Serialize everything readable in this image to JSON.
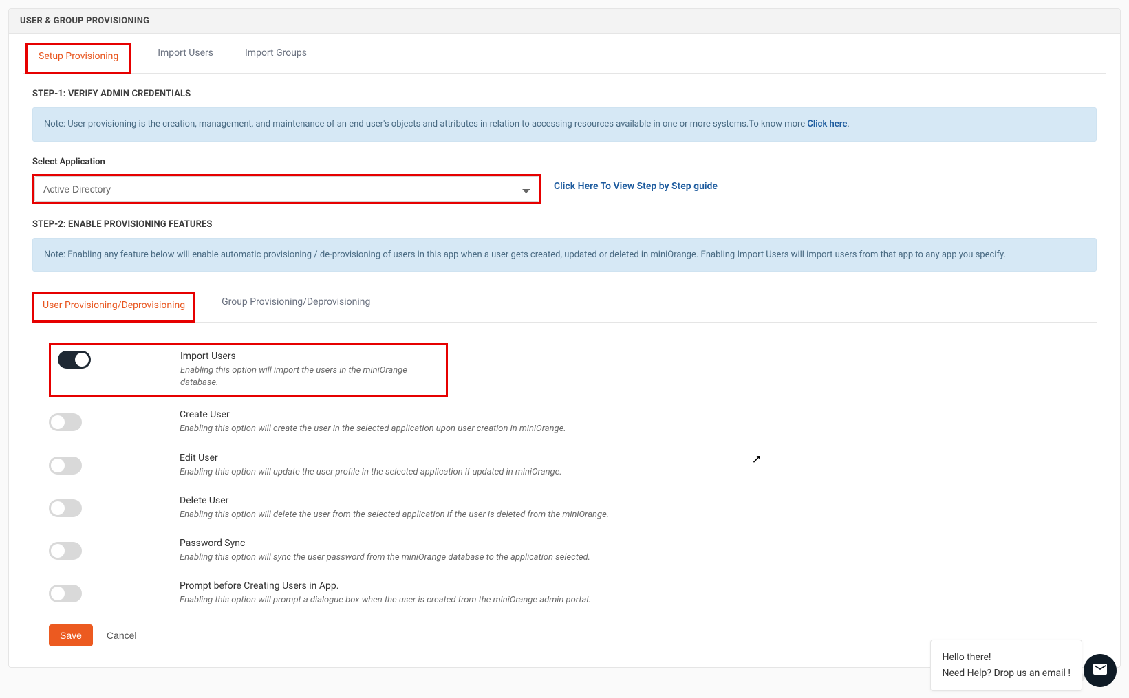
{
  "colors": {
    "accent": "#ec5a20",
    "highlight": "#e60000",
    "note_bg": "#d6e8f5",
    "toggle_on": "#1e2833"
  },
  "panel": {
    "title": "USER & GROUP PROVISIONING"
  },
  "tabs": [
    {
      "label": "Setup Provisioning",
      "active": true,
      "highlighted": true
    },
    {
      "label": "Import Users",
      "active": false
    },
    {
      "label": "Import Groups",
      "active": false
    }
  ],
  "step1": {
    "heading": "STEP-1: VERIFY ADMIN CREDENTIALS",
    "note_text": "Note: User provisioning is the creation, management, and maintenance of an end user's objects and attributes in relation to accessing resources available in one or more systems.To know more ",
    "note_link": "Click here",
    "note_suffix": ".",
    "field_label": "Select Application",
    "select_value": "Active Directory",
    "guide_link": "Click Here To View Step by Step guide"
  },
  "step2": {
    "heading": "STEP-2: ENABLE PROVISIONING FEATURES",
    "note_text": "Note: Enabling any feature below will enable automatic provisioning / de-provisioning of users in this app when a user gets created, updated or deleted in miniOrange. Enabling Import Users will import users from that app to any app you specify."
  },
  "subtabs": [
    {
      "label": "User Provisioning/Deprovisioning",
      "active": true,
      "highlighted": true
    },
    {
      "label": "Group Provisioning/Deprovisioning",
      "active": false
    }
  ],
  "features": [
    {
      "title": "Import Users",
      "desc": "Enabling this option will import the users in the miniOrange database.",
      "on": true,
      "highlighted": true
    },
    {
      "title": "Create User",
      "desc": "Enabling this option will create the user in the selected application upon user creation in miniOrange.",
      "on": false
    },
    {
      "title": "Edit User",
      "desc": "Enabling this option will update the user profile in the selected application if updated in miniOrange.",
      "on": false
    },
    {
      "title": "Delete User",
      "desc": "Enabling this option will delete the user from the selected application if the user is deleted from the miniOrange.",
      "on": false
    },
    {
      "title": "Password Sync",
      "desc": "Enabling this option will sync the user password from the miniOrange database to the application selected.",
      "on": false
    },
    {
      "title": "Prompt before Creating Users in App.",
      "desc": "Enabling this option will prompt a dialogue box when the user is created from the miniOrange admin portal.",
      "on": false
    }
  ],
  "actions": {
    "save": "Save",
    "cancel": "Cancel"
  },
  "help": {
    "greeting": "Hello there!",
    "message": "Need Help? Drop us an email !"
  }
}
